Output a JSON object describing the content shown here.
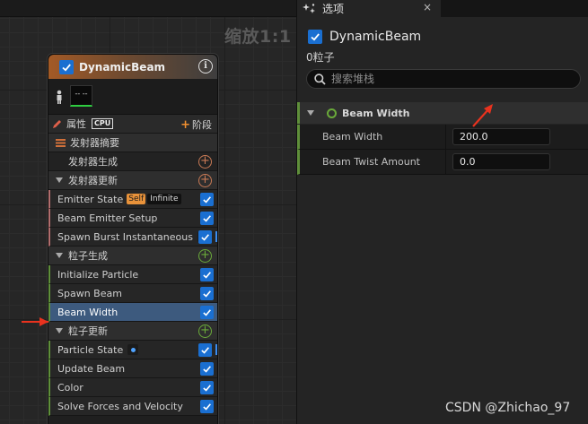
{
  "graph": {
    "zoom_label": "缩放1:1"
  },
  "node": {
    "title": "DynamicBeam",
    "thumb_text": "-- --",
    "props_label": "属性",
    "cpu_label": "CPU",
    "stage_label": "阶段",
    "emitter_summary": "发射器摘要",
    "emitter_spawn": "发射器生成",
    "emitter_update": "发射器更新",
    "emitter_update_items": [
      {
        "label": "Emitter State",
        "badge_self": "Self",
        "badge_infinite": "Infinite"
      },
      {
        "label": "Beam Emitter Setup"
      },
      {
        "label": "Spawn Burst Instantaneous"
      }
    ],
    "particle_spawn": "粒子生成",
    "particle_spawn_items": [
      {
        "label": "Initialize Particle"
      },
      {
        "label": "Spawn Beam"
      },
      {
        "label": "Beam Width"
      }
    ],
    "particle_update": "粒子更新",
    "particle_update_items": [
      {
        "label": "Particle State"
      },
      {
        "label": "Update Beam"
      },
      {
        "label": "Color"
      },
      {
        "label": "Solve Forces and Velocity"
      }
    ]
  },
  "panel": {
    "tab_label": "选项",
    "tab_close": "×",
    "title": "DynamicBeam",
    "particle_count": "0粒子",
    "search_placeholder": "搜索堆栈",
    "category": "Beam Width",
    "properties": [
      {
        "label": "Beam Width",
        "value": "200.0"
      },
      {
        "label": "Beam Twist Amount",
        "value": "0.0"
      }
    ]
  },
  "watermark": "CSDN @Zhichao_97",
  "colors": {
    "accent_blue": "#1a6fd1",
    "selected_row": "#3d5a7e",
    "spawn_green": "#5f8f3a",
    "emitter_pink": "#b06d6d",
    "arrow_red": "#e8321e"
  }
}
